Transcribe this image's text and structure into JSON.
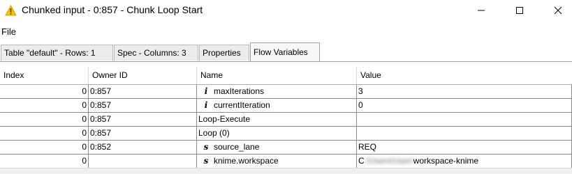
{
  "window": {
    "title": "Chunked input - 0:857 - Chunk Loop Start",
    "icon": "warning-triangle-icon",
    "accent_color": "#f4c20d"
  },
  "menu": {
    "items": [
      "File"
    ]
  },
  "tabs": [
    {
      "label": "Table \"default\" - Rows: 1",
      "active": false
    },
    {
      "label": "Spec - Columns: 3",
      "active": false
    },
    {
      "label": "Properties",
      "active": false
    },
    {
      "label": "Flow Variables",
      "active": true
    }
  ],
  "table": {
    "columns": [
      "Index",
      "Owner ID",
      "Name",
      "Value"
    ],
    "rows": [
      {
        "index": "0",
        "owner": "0:857",
        "type_icon": "i",
        "name": "maxIterations",
        "value": "3"
      },
      {
        "index": "0",
        "owner": "0:857",
        "type_icon": "i",
        "name": "currentIteration",
        "value": "0"
      },
      {
        "index": "0",
        "owner": "0:857",
        "type_icon": "",
        "name": "Loop-Execute",
        "value": ""
      },
      {
        "index": "0",
        "owner": "0:857",
        "type_icon": "",
        "name": "Loop (0)",
        "value": ""
      },
      {
        "index": "0",
        "owner": "0:852",
        "type_icon": "s",
        "name": "source_lane",
        "value": "REQ"
      },
      {
        "index": "0",
        "owner": "",
        "type_icon": "s",
        "name": "knime.workspace",
        "value_prefix": "C",
        "value_blurred": ":\\Users\\User\\",
        "value_suffix": "workspace-knime"
      }
    ]
  }
}
